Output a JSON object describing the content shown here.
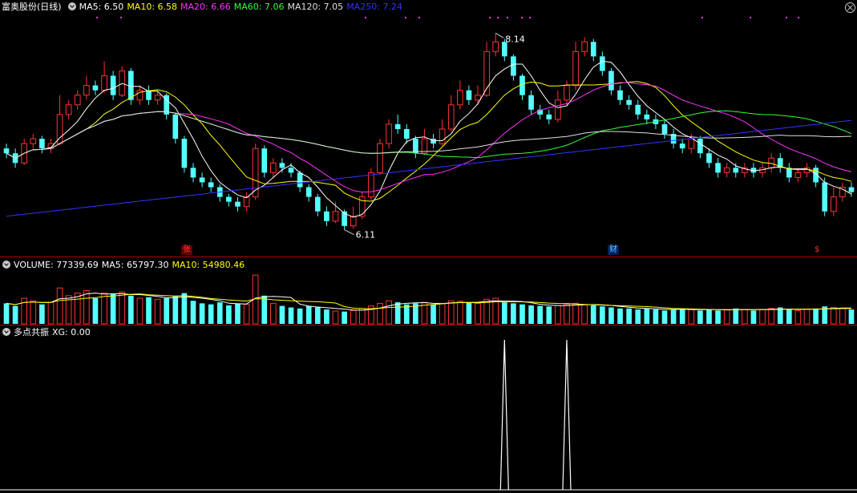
{
  "main": {
    "stock_name": "富奥股份(日线)",
    "indicators": [
      {
        "label": "MA5: 6.50",
        "color": "#ffffff"
      },
      {
        "label": "MA10: 6.58",
        "color": "#ffff00"
      },
      {
        "label": "MA20: 6.66",
        "color": "#ff33ff"
      },
      {
        "label": "MA60: 7.06",
        "color": "#33ff33"
      },
      {
        "label": "MA120: 7.05",
        "color": "#e0e0e0"
      },
      {
        "label": "MA250: 7.24",
        "color": "#3333ff"
      }
    ],
    "high_label": "8.14",
    "low_label": "6.11",
    "markers": [
      {
        "text": "张",
        "color": "#ff4040",
        "bg": "#600000"
      },
      {
        "text": "财",
        "color": "#66ccff",
        "bg": "#002060"
      },
      {
        "text": "$",
        "color": "#ff3030",
        "bg": "#000000"
      }
    ]
  },
  "volume": {
    "label": "VOLUME: 77339.69",
    "ma5": "MA5: 65797.30",
    "ma10": "MA10: 54980.46",
    "colors": {
      "label": "#ffffff",
      "ma5": "#ffffff",
      "ma10": "#ffff00"
    }
  },
  "indicator": {
    "name": "多点共振",
    "xg": "XG: 0.00"
  },
  "colors": {
    "up": "#ff3232",
    "down": "#54ffff",
    "ma5": "#ffffff",
    "ma10": "#ffff00",
    "ma20": "#ff33ff",
    "ma60": "#33ff33",
    "ma120": "#e0e0e0",
    "ma250": "#3333ff"
  },
  "chart_data": {
    "type": "candlestick",
    "title": "富奥股份(日线)",
    "price_range": [
      6.0,
      8.3
    ],
    "high": 8.14,
    "low": 6.11,
    "candles": [
      [
        6.95,
        6.9,
        7.0,
        6.85
      ],
      [
        6.9,
        6.8,
        6.95,
        6.75
      ],
      [
        6.8,
        7.0,
        7.05,
        6.78
      ],
      [
        7.0,
        7.05,
        7.1,
        6.95
      ],
      [
        7.05,
        6.95,
        7.08,
        6.9
      ],
      [
        6.95,
        7.0,
        7.05,
        6.9
      ],
      [
        7.0,
        7.3,
        7.5,
        6.98
      ],
      [
        7.3,
        7.4,
        7.45,
        7.25
      ],
      [
        7.4,
        7.5,
        7.55,
        7.35
      ],
      [
        7.5,
        7.6,
        7.7,
        7.45
      ],
      [
        7.6,
        7.55,
        7.65,
        7.5
      ],
      [
        7.55,
        7.7,
        7.85,
        7.52
      ],
      [
        7.7,
        7.5,
        7.75,
        7.45
      ],
      [
        7.5,
        7.75,
        7.8,
        7.48
      ],
      [
        7.75,
        7.45,
        7.78,
        7.4
      ],
      [
        7.45,
        7.55,
        7.6,
        7.4
      ],
      [
        7.55,
        7.45,
        7.6,
        7.4
      ],
      [
        7.45,
        7.5,
        7.55,
        7.4
      ],
      [
        7.5,
        7.3,
        7.52,
        7.25
      ],
      [
        7.3,
        7.05,
        7.32,
        7.0
      ],
      [
        7.05,
        6.75,
        7.08,
        6.7
      ],
      [
        6.75,
        6.65,
        6.8,
        6.6
      ],
      [
        6.65,
        6.6,
        6.7,
        6.55
      ],
      [
        6.6,
        6.55,
        6.65,
        6.5
      ],
      [
        6.55,
        6.45,
        6.58,
        6.4
      ],
      [
        6.45,
        6.4,
        6.48,
        6.35
      ],
      [
        6.4,
        6.35,
        6.45,
        6.3
      ],
      [
        6.35,
        6.45,
        6.5,
        6.3
      ],
      [
        6.45,
        6.95,
        7.0,
        6.42
      ],
      [
        6.95,
        6.7,
        6.98,
        6.65
      ],
      [
        6.7,
        6.8,
        6.85,
        6.65
      ],
      [
        6.8,
        6.75,
        6.85,
        6.7
      ],
      [
        6.75,
        6.7,
        6.8,
        6.65
      ],
      [
        6.7,
        6.55,
        6.72,
        6.5
      ],
      [
        6.55,
        6.45,
        6.58,
        6.4
      ],
      [
        6.45,
        6.3,
        6.48,
        6.25
      ],
      [
        6.3,
        6.2,
        6.35,
        6.15
      ],
      [
        6.2,
        6.3,
        6.4,
        6.18
      ],
      [
        6.3,
        6.15,
        6.32,
        6.11
      ],
      [
        6.15,
        6.25,
        6.35,
        6.12
      ],
      [
        6.25,
        6.45,
        6.5,
        6.22
      ],
      [
        6.45,
        6.7,
        6.75,
        6.42
      ],
      [
        6.7,
        7.0,
        7.05,
        6.68
      ],
      [
        7.0,
        7.2,
        7.25,
        6.95
      ],
      [
        7.2,
        7.15,
        7.3,
        7.1
      ],
      [
        7.15,
        7.05,
        7.2,
        7.0
      ],
      [
        7.05,
        6.9,
        7.08,
        6.85
      ],
      [
        6.9,
        7.05,
        7.15,
        6.88
      ],
      [
        7.05,
        7.0,
        7.1,
        6.95
      ],
      [
        7.0,
        7.15,
        7.25,
        6.98
      ],
      [
        7.15,
        7.4,
        7.5,
        7.12
      ],
      [
        7.4,
        7.55,
        7.65,
        7.35
      ],
      [
        7.55,
        7.45,
        7.6,
        7.4
      ],
      [
        7.45,
        7.5,
        7.6,
        7.4
      ],
      [
        7.5,
        7.95,
        8.05,
        7.48
      ],
      [
        7.95,
        8.05,
        8.14,
        7.9
      ],
      [
        8.05,
        7.9,
        8.08,
        7.85
      ],
      [
        7.9,
        7.7,
        7.92,
        7.65
      ],
      [
        7.7,
        7.5,
        7.72,
        7.45
      ],
      [
        7.5,
        7.35,
        7.55,
        7.3
      ],
      [
        7.35,
        7.3,
        7.4,
        7.25
      ],
      [
        7.3,
        7.25,
        7.35,
        7.2
      ],
      [
        7.25,
        7.45,
        7.55,
        7.22
      ],
      [
        7.45,
        7.6,
        7.65,
        7.4
      ],
      [
        7.6,
        7.95,
        8.05,
        7.55
      ],
      [
        7.95,
        8.05,
        8.1,
        7.9
      ],
      [
        8.05,
        7.9,
        8.08,
        7.85
      ],
      [
        7.9,
        7.75,
        7.95,
        7.7
      ],
      [
        7.75,
        7.55,
        7.78,
        7.5
      ],
      [
        7.55,
        7.45,
        7.6,
        7.4
      ],
      [
        7.45,
        7.4,
        7.5,
        7.35
      ],
      [
        7.4,
        7.3,
        7.45,
        7.25
      ],
      [
        7.3,
        7.25,
        7.35,
        7.2
      ],
      [
        7.25,
        7.2,
        7.3,
        7.15
      ],
      [
        7.2,
        7.1,
        7.25,
        7.05
      ],
      [
        7.1,
        7.0,
        7.15,
        6.95
      ],
      [
        7.0,
        6.95,
        7.05,
        6.9
      ],
      [
        6.95,
        7.05,
        7.1,
        6.9
      ],
      [
        7.05,
        6.9,
        7.08,
        6.85
      ],
      [
        6.9,
        6.8,
        6.95,
        6.75
      ],
      [
        6.8,
        6.7,
        6.85,
        6.65
      ],
      [
        6.7,
        6.75,
        6.8,
        6.65
      ],
      [
        6.75,
        6.7,
        6.8,
        6.65
      ],
      [
        6.7,
        6.75,
        6.8,
        6.65
      ],
      [
        6.75,
        6.7,
        6.8,
        6.65
      ],
      [
        6.7,
        6.75,
        6.8,
        6.65
      ],
      [
        6.75,
        6.85,
        6.9,
        6.7
      ],
      [
        6.85,
        6.75,
        6.9,
        6.7
      ],
      [
        6.75,
        6.65,
        6.8,
        6.6
      ],
      [
        6.65,
        6.7,
        6.75,
        6.6
      ],
      [
        6.7,
        6.75,
        6.8,
        6.65
      ],
      [
        6.75,
        6.6,
        6.78,
        6.55
      ],
      [
        6.6,
        6.3,
        6.65,
        6.25
      ],
      [
        6.3,
        6.45,
        6.55,
        6.25
      ],
      [
        6.45,
        6.55,
        6.6,
        6.4
      ],
      [
        6.55,
        6.5,
        6.6,
        6.45
      ]
    ],
    "volumes": [
      40,
      35,
      50,
      45,
      38,
      42,
      70,
      55,
      60,
      65,
      50,
      60,
      58,
      62,
      55,
      50,
      52,
      48,
      50,
      55,
      60,
      45,
      40,
      38,
      42,
      36,
      40,
      38,
      95,
      55,
      40,
      35,
      32,
      30,
      35,
      32,
      28,
      25,
      24,
      26,
      30,
      35,
      40,
      45,
      42,
      38,
      40,
      42,
      38,
      40,
      45,
      44,
      42,
      40,
      48,
      50,
      42,
      40,
      38,
      36,
      35,
      34,
      36,
      38,
      40,
      38,
      36,
      34,
      32,
      30,
      30,
      28,
      30,
      28,
      26,
      28,
      30,
      28,
      26,
      28,
      26,
      28,
      30,
      28,
      26,
      28,
      30,
      32,
      28,
      26,
      28,
      30,
      34,
      32,
      30,
      28
    ],
    "signal_indices": [
      56,
      63
    ],
    "series": [
      {
        "name": "MA5"
      },
      {
        "name": "MA10"
      },
      {
        "name": "MA20"
      },
      {
        "name": "MA60"
      },
      {
        "name": "MA120"
      },
      {
        "name": "MA250"
      }
    ]
  }
}
